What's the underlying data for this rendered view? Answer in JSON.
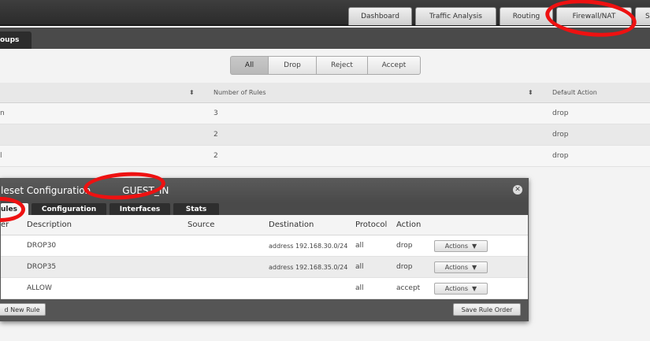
{
  "nav": {
    "tabs": [
      {
        "label": "Dashboard"
      },
      {
        "label": "Traffic Analysis"
      },
      {
        "label": "Routing"
      },
      {
        "label": "Firewall/NAT"
      },
      {
        "label": "Se"
      }
    ]
  },
  "subnav": {
    "active_label": "oups"
  },
  "filter": {
    "options": [
      "All",
      "Drop",
      "Reject",
      "Accept"
    ],
    "selected": "All"
  },
  "rulesets_table": {
    "columns": [
      "Number of Rules",
      "Default Action"
    ],
    "rows": [
      {
        "name": "n",
        "rules": "3",
        "action": "drop"
      },
      {
        "name": "",
        "rules": "2",
        "action": "drop"
      },
      {
        "name": "l",
        "rules": "2",
        "action": "drop"
      }
    ]
  },
  "modal": {
    "title": "leset Configuration",
    "ruleset_name": "GUEST_IN",
    "tabs": [
      "ules",
      "Configuration",
      "Interfaces",
      "Stats"
    ],
    "active_tab": "ules",
    "columns": [
      "er",
      "Description",
      "Source",
      "Destination",
      "Protocol",
      "Action"
    ],
    "rules": [
      {
        "description": "DROP30",
        "source": "",
        "destination": "address 192.168.30.0/24",
        "protocol": "all",
        "action": "drop",
        "actions_label": "Actions"
      },
      {
        "description": "DROP35",
        "source": "",
        "destination": "address 192.168.35.0/24",
        "protocol": "all",
        "action": "drop",
        "actions_label": "Actions"
      },
      {
        "description": "ALLOW",
        "source": "",
        "destination": "",
        "protocol": "all",
        "action": "accept",
        "actions_label": "Actions"
      }
    ],
    "add_rule_label": "d New Rule",
    "save_order_label": "Save Rule Order"
  },
  "colors": {
    "annotation": "#ee1111",
    "topbar": "#333333"
  }
}
